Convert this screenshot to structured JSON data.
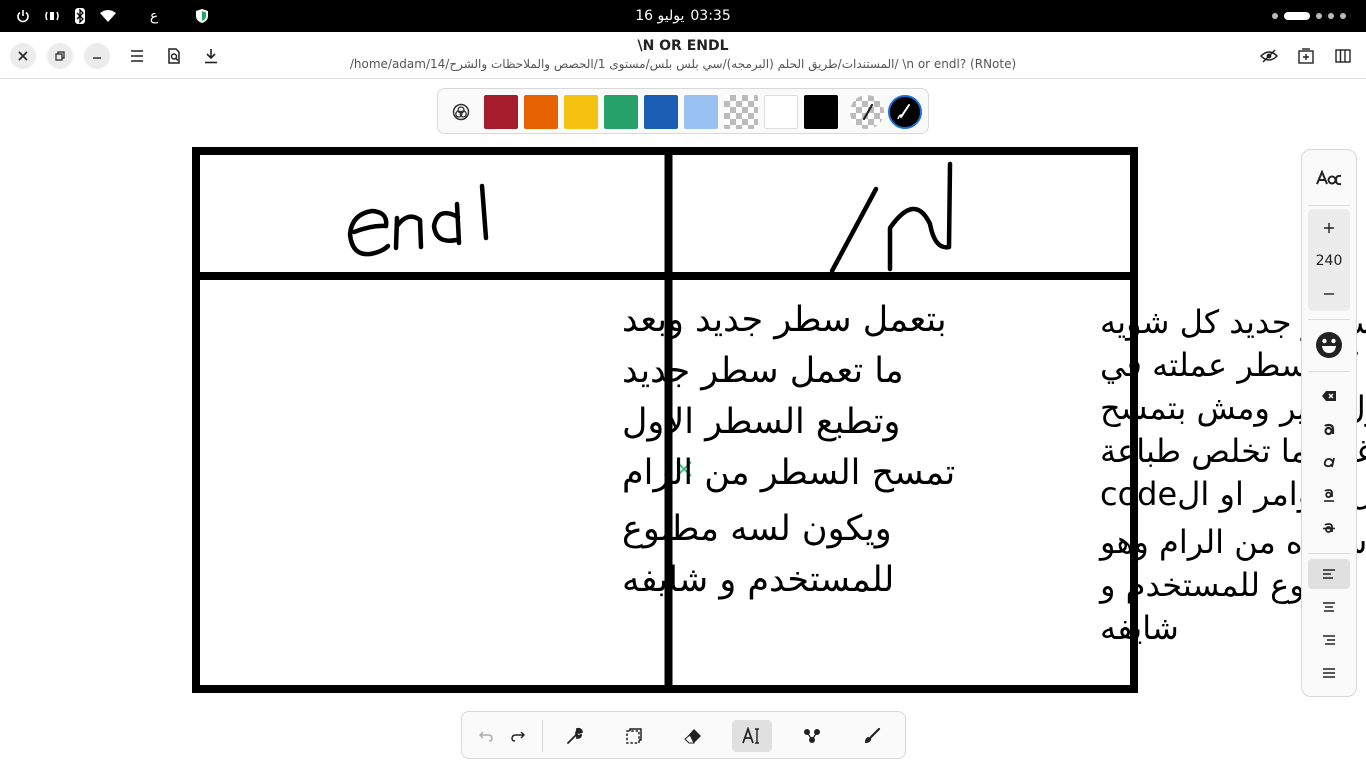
{
  "system_bar": {
    "date": "16 يوليو",
    "time": "03:35",
    "keyboard_layout": "ع",
    "icons": [
      "power-icon",
      "audio-icon",
      "bluetooth-icon",
      "wifi-icon",
      "keyboard-layout-indicator",
      "shield-icon"
    ]
  },
  "header": {
    "title": "\\N OR ENDL",
    "subtitle": "/home/adam/14/المستندات/طريق الحلم (البرمجه)/سي بلس بلس/مستوى 1/الحصص والملاحظات والشرح/ \\n or endl? (RNote)"
  },
  "palette": {
    "colors": [
      "#a51d2d",
      "#e66100",
      "#f5c211",
      "#26a269",
      "#1a5fb4",
      "#99c1f1",
      "transparent",
      "#ffffff",
      "#000000"
    ]
  },
  "document": {
    "left_header_handwriting": "endl",
    "right_header_handwriting": "\\n",
    "left_text": [
      "بتعمل سطر جديد وبعد",
      "ما تعمل سطر جديد",
      "وتطبع السطر الاول",
      "تمسح السطر من الرام",
      "ويكون لسه مطبوع",
      "للمستخدم و شايفه"
    ],
    "right_text": [
      "بتعمل سطر جديد كل شويه",
      "وتسيف كل سطر عملته في",
      "جدول كبير ومش بتمسح",
      "الجدول غير لما تخلص طباعة",
      "كل الاوامر او الcode",
      "وتقوم شايلاه من الرام وهو",
      "لسه مطبوع للمستخدم و",
      "شايفه"
    ]
  },
  "side_panel": {
    "font_size": "240"
  },
  "colors": {
    "accent": "#1c71d8",
    "cursor_marker": "#2ec27e"
  }
}
